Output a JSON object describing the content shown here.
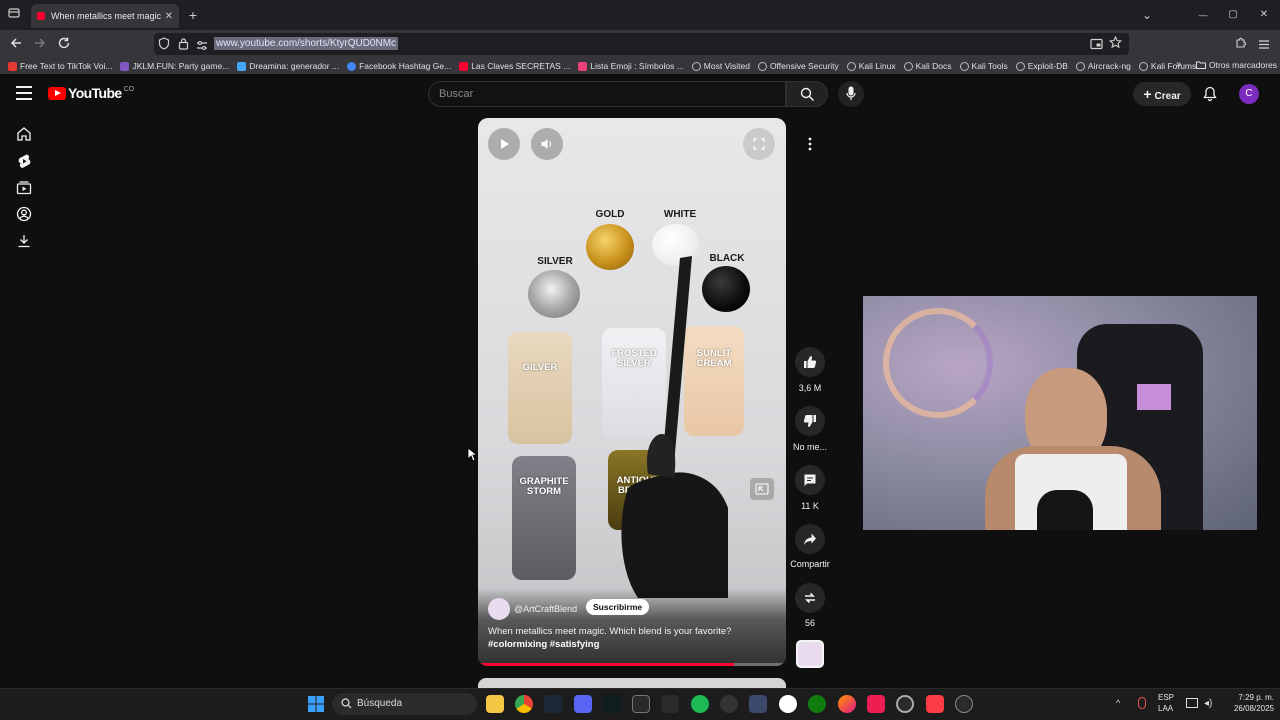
{
  "browser": {
    "tab_title": "When metallics meet magic. W",
    "tab_close": "✕",
    "new_tab": "+",
    "url": "www.youtube.com/shorts/KtyrQUD0NMc",
    "window_controls": {
      "minimize": "—",
      "maximize": "▢",
      "close": "✕",
      "tabs_dropdown": "⌄"
    },
    "bookmarks": [
      {
        "label": "Free Text to TikTok Voi...",
        "color": "#e53935"
      },
      {
        "label": "JKLM.FUN: Party game...",
        "color": "#7e57c2"
      },
      {
        "label": "Dreamina: generador ...",
        "color": "#42a5f5"
      },
      {
        "label": "Facebook Hashtag Ge...",
        "color": "#4285f4"
      },
      {
        "label": "Las Claves SECRETAS ...",
        "color": "#ff0033"
      },
      {
        "label": "Lista Emoji : Símbolos ...",
        "color": "#ec407a"
      },
      {
        "label": "Most Visited",
        "color": "#9e9e9e"
      },
      {
        "label": "Offensive Security",
        "color": "#9e9e9e"
      },
      {
        "label": "Kali Linux",
        "color": "#9e9e9e"
      },
      {
        "label": "Kali Docs",
        "color": "#9e9e9e"
      },
      {
        "label": "Kali Tools",
        "color": "#9e9e9e"
      },
      {
        "label": "Exploit-DB",
        "color": "#9e9e9e"
      },
      {
        "label": "Aircrack-ng",
        "color": "#9e9e9e"
      },
      {
        "label": "Kali Forums",
        "color": "#9e9e9e"
      }
    ],
    "bookmarks_overflow": "»",
    "other_bookmarks": "Otros marcadores"
  },
  "youtube": {
    "logo_text": "YouTube",
    "logo_country": "CO",
    "search_placeholder": "Buscar",
    "create_label": "Crear",
    "create_plus": "+",
    "avatar_letter": "C",
    "accent": "#ff0033"
  },
  "short": {
    "swatches": {
      "gold": "GOLD",
      "white": "WHITE",
      "silver": "SILVER",
      "black": "BLACK"
    },
    "paints": {
      "gilver": "GILVER",
      "frosted_silver": "FROSTED SILVER",
      "sunlit_cream": "SUNLIT CREAM",
      "graphite_storm": "GRAPHITE STORM",
      "antique_bronze": "ANTIQUE BRONZE"
    },
    "channel": "@ArtCraftBlend",
    "subscribe": "Suscribirme",
    "description": "When metallics meet magic. Which blend is your favorite?",
    "hashtags": "#colormixing #satisfying",
    "progress": 0.83
  },
  "actions": {
    "likes": "3,6 M",
    "dislike": "No me...",
    "comments": "11 K",
    "share": "Compartir",
    "remix": "56"
  },
  "taskbar": {
    "search": "Búsqueda",
    "lang1": "ESP",
    "lang2": "LAA",
    "time": "7:29 p. m.",
    "date": "26/08/2025"
  }
}
